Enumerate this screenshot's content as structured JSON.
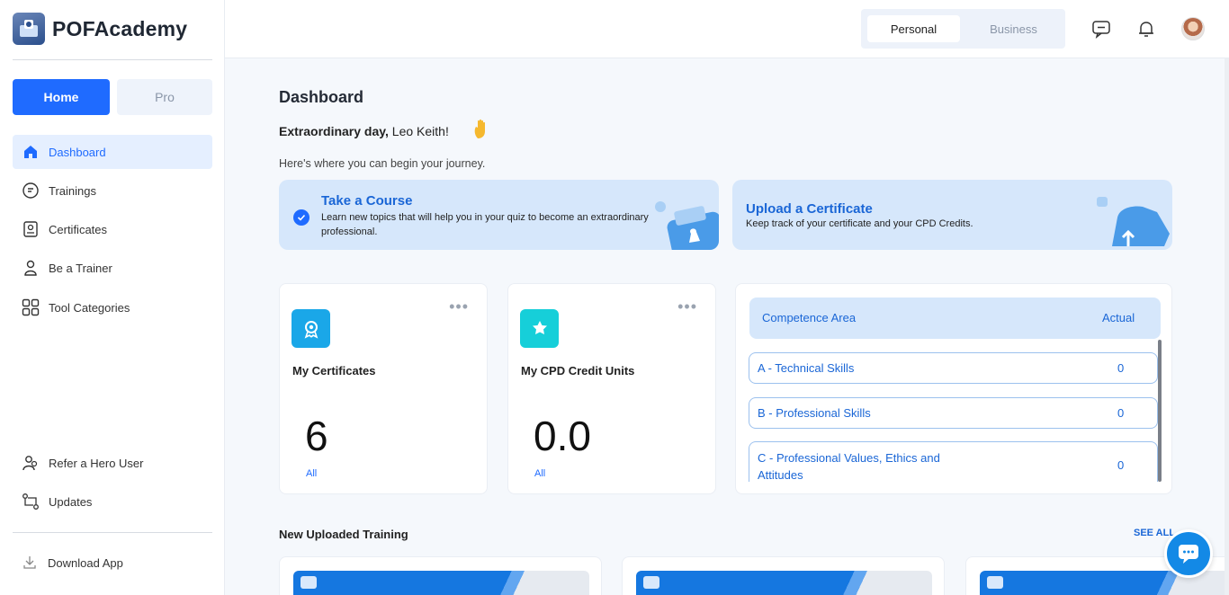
{
  "brand": {
    "name": "POFAcademy"
  },
  "mode_tabs": {
    "home": "Home",
    "pro": "Pro"
  },
  "sidebar": {
    "items": [
      {
        "label": "Dashboard",
        "icon": "home-icon"
      },
      {
        "label": "Trainings",
        "icon": "trainings-icon"
      },
      {
        "label": "Certificates",
        "icon": "certificate-icon"
      },
      {
        "label": "Be a Trainer",
        "icon": "user-icon"
      },
      {
        "label": "Tool Categories",
        "icon": "grid-icon"
      }
    ],
    "bottom_items": [
      {
        "label": "Refer a Hero User",
        "icon": "users-icon"
      },
      {
        "label": "Updates",
        "icon": "updates-icon"
      }
    ],
    "download": {
      "label": "Download App",
      "icon": "download-icon"
    }
  },
  "topbar": {
    "account_toggle": {
      "personal": "Personal",
      "business": "Business",
      "selected": "Personal"
    }
  },
  "main": {
    "title": "Dashboard",
    "greeting_bold": "Extraordinary day,",
    "greeting_name": "Leo Keith!",
    "subtitle": "Here's where you can begin your journey.",
    "banners": [
      {
        "title": "Take a Course",
        "text": "Learn new topics that will help you in your quiz to become an extraordinary professional."
      },
      {
        "title": "Upload a Certificate",
        "text": "Keep track of your certificate and your CPD Credits."
      }
    ],
    "stats": [
      {
        "title": "My Certificates",
        "value": "6",
        "link": "All"
      },
      {
        "title": "My CPD Credit Units",
        "value": "0.0",
        "link": "All"
      }
    ],
    "competence": {
      "headers": {
        "area": "Competence Area",
        "actual": "Actual"
      },
      "rows": [
        {
          "area": "A - Technical Skills",
          "actual": "0"
        },
        {
          "area": "B - Professional Skills",
          "actual": "0"
        },
        {
          "area": "C - Professional Values, Ethics and Attitudes",
          "actual": "0"
        }
      ]
    },
    "new_trainings": {
      "title": "New Uploaded Training",
      "see_all": "SEE ALL"
    }
  },
  "colors": {
    "accent": "#1f6bff",
    "banner_bg": "#d6e7fb",
    "cert_tile": "#1aa7e8",
    "cpd_tile": "#16cfd9"
  }
}
